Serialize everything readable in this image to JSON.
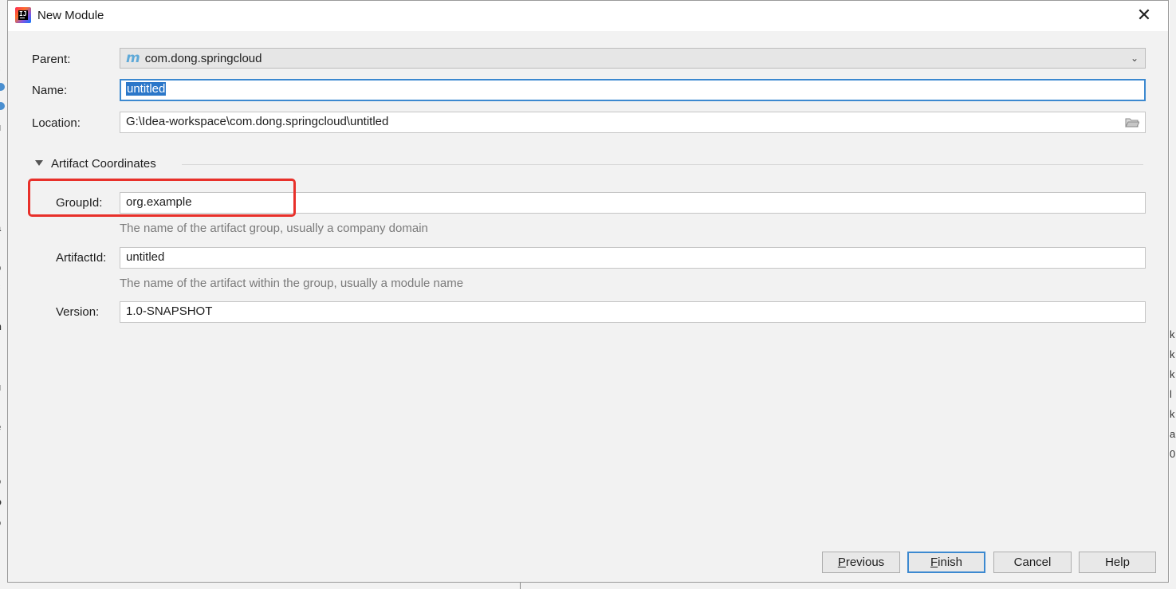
{
  "window": {
    "title": "New Module"
  },
  "form": {
    "parent": {
      "label": "Parent:",
      "value": "com.dong.springcloud"
    },
    "name": {
      "label": "Name:",
      "value": "untitled"
    },
    "location": {
      "label": "Location:",
      "value": "G:\\Idea-workspace\\com.dong.springcloud\\untitled"
    }
  },
  "artifact": {
    "section_title": "Artifact Coordinates",
    "groupid": {
      "label": "GroupId:",
      "value": "org.example",
      "hint": "The name of the artifact group, usually a company domain"
    },
    "artifactid": {
      "label": "ArtifactId:",
      "value": "untitled",
      "hint": "The name of the artifact within the group, usually a module name"
    },
    "version": {
      "label": "Version:",
      "value": "1.0-SNAPSHOT"
    }
  },
  "buttons": {
    "previous": {
      "mnemonic": "P",
      "rest": "revious"
    },
    "finish": {
      "mnemonic": "F",
      "rest": "inish"
    },
    "cancel": "Cancel",
    "help": "Help"
  },
  "colors": {
    "accent": "#3c89d0",
    "annotation": "#e8302a",
    "selection": "#2b77c9"
  },
  "icons": [
    "maven-module-icon",
    "folder-icon",
    "close-icon",
    "collapse-triangle-icon",
    "intellij-app-icon"
  ]
}
